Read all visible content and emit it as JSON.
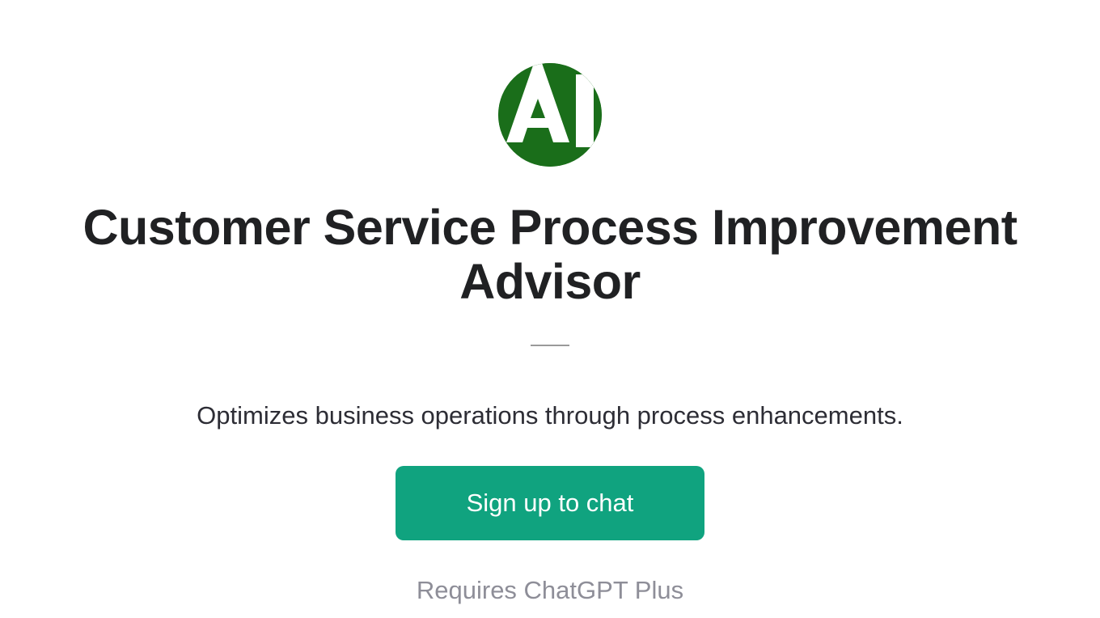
{
  "logo": {
    "icon_name": "ai-logo-icon",
    "bg_color": "#1a6e1a",
    "fg_color": "#ffffff"
  },
  "title": "Customer Service Process Improvement Advisor",
  "subtitle": "Optimizes business operations through process enhancements.",
  "cta": {
    "label": "Sign up to chat"
  },
  "footnote": "Requires ChatGPT Plus"
}
